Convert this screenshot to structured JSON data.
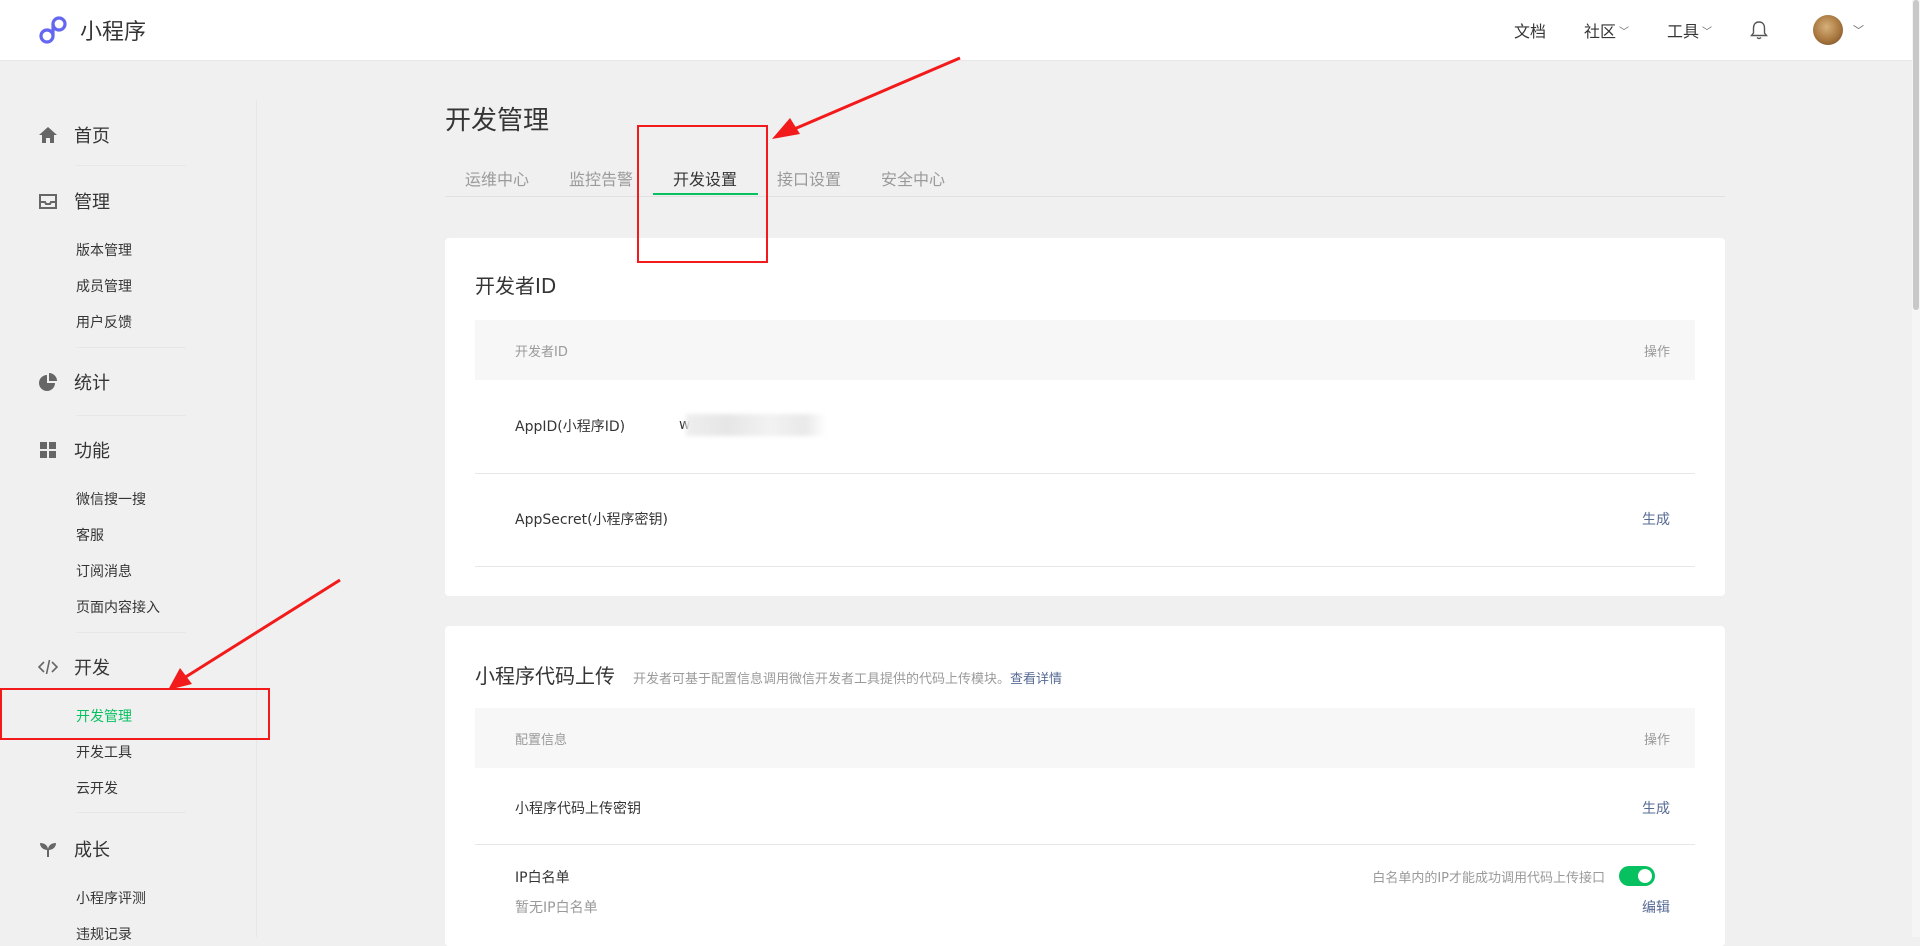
{
  "app": {
    "name": "小程序"
  },
  "topnav": {
    "docs": "文档",
    "community": "社区",
    "tools": "工具"
  },
  "sidebar": {
    "home": "首页",
    "manage": {
      "label": "管理",
      "items": [
        "版本管理",
        "成员管理",
        "用户反馈"
      ]
    },
    "stats": "统计",
    "features": {
      "label": "功能",
      "items": [
        "微信搜一搜",
        "客服",
        "订阅消息",
        "页面内容接入"
      ]
    },
    "dev": {
      "label": "开发",
      "items": [
        "开发管理",
        "开发工具",
        "云开发"
      ]
    },
    "growth": {
      "label": "成长",
      "items": [
        "小程序评测",
        "违规记录"
      ]
    }
  },
  "page": {
    "title": "开发管理",
    "tabs": [
      "运维中心",
      "监控告警",
      "开发设置",
      "接口设置",
      "安全中心"
    ],
    "active_tab": "开发设置"
  },
  "dev_id_card": {
    "title": "开发者ID",
    "col_left": "开发者ID",
    "col_right": "操作",
    "appid_label": "AppID(小程序ID)",
    "appid_value_prefix": "w",
    "secret_label": "AppSecret(小程序密钥)",
    "secret_action": "生成"
  },
  "upload_card": {
    "title": "小程序代码上传",
    "desc": "开发者可基于配置信息调用微信开发者工具提供的代码上传模块。",
    "desc_link": "查看详情",
    "col_left": "配置信息",
    "col_right": "操作",
    "key_label": "小程序代码上传密钥",
    "key_action": "生成",
    "ip_label": "IP白名单",
    "ip_hint": "白名单内的IP才能成功调用代码上传接口",
    "ip_empty": "暂无IP白名单",
    "ip_action": "编辑",
    "ip_toggle_on": true
  },
  "colors": {
    "accent": "#07c160",
    "link": "#576b95",
    "annotation": "#f21a1a"
  }
}
